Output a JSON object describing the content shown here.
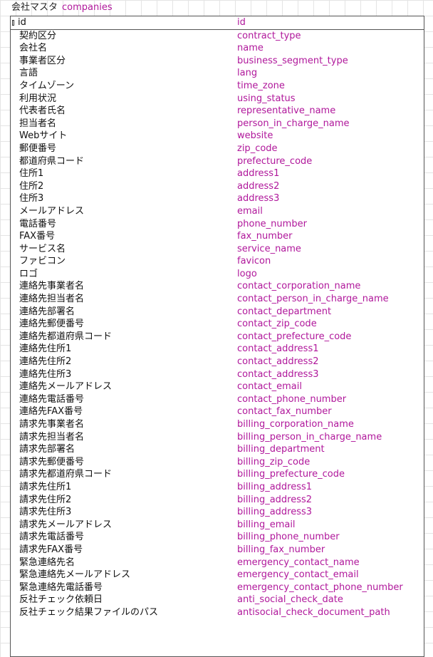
{
  "entity": {
    "logical_name": "会社マスタ",
    "physical_name": "companies"
  },
  "primary_key": {
    "logical": "id",
    "physical": "id"
  },
  "attributes": [
    {
      "logical": "契約区分",
      "physical": "contract_type"
    },
    {
      "logical": "会社名",
      "physical": "name"
    },
    {
      "logical": "事業者区分",
      "physical": "business_segment_type"
    },
    {
      "logical": "言語",
      "physical": "lang"
    },
    {
      "logical": "タイムゾーン",
      "physical": "time_zone"
    },
    {
      "logical": "利用状況",
      "physical": "using_status"
    },
    {
      "logical": "代表者氏名",
      "physical": "representative_name"
    },
    {
      "logical": "担当者名",
      "physical": "person_in_charge_name"
    },
    {
      "logical": "Webサイト",
      "physical": "website"
    },
    {
      "logical": "郵便番号",
      "physical": "zip_code"
    },
    {
      "logical": "都道府県コード",
      "physical": "prefecture_code"
    },
    {
      "logical": "住所1",
      "physical": "address1"
    },
    {
      "logical": "住所2",
      "physical": "address2"
    },
    {
      "logical": "住所3",
      "physical": "address3"
    },
    {
      "logical": "メールアドレス",
      "physical": "email"
    },
    {
      "logical": "電話番号",
      "physical": "phone_number"
    },
    {
      "logical": "FAX番号",
      "physical": "fax_number"
    },
    {
      "logical": "サービス名",
      "physical": "service_name"
    },
    {
      "logical": "ファビコン",
      "physical": "favicon"
    },
    {
      "logical": "ロゴ",
      "physical": "logo"
    },
    {
      "logical": "連絡先事業者名",
      "physical": "contact_corporation_name"
    },
    {
      "logical": "連絡先担当者名",
      "physical": "contact_person_in_charge_name"
    },
    {
      "logical": "連絡先部署名",
      "physical": "contact_department"
    },
    {
      "logical": "連絡先郵便番号",
      "physical": "contact_zip_code"
    },
    {
      "logical": "連絡先都道府県コード",
      "physical": "contact_prefecture_code"
    },
    {
      "logical": "連絡先住所1",
      "physical": "contact_address1"
    },
    {
      "logical": "連絡先住所2",
      "physical": "contact_address2"
    },
    {
      "logical": "連絡先住所3",
      "physical": "contact_address3"
    },
    {
      "logical": "連絡先メールアドレス",
      "physical": "contact_email"
    },
    {
      "logical": "連絡先電話番号",
      "physical": "contact_phone_number"
    },
    {
      "logical": "連絡先FAX番号",
      "physical": "contact_fax_number"
    },
    {
      "logical": "請求先事業者名",
      "physical": "billing_corporation_name"
    },
    {
      "logical": "請求先担当者名",
      "physical": "billing_person_in_charge_name"
    },
    {
      "logical": "請求先部署名",
      "physical": "billing_department"
    },
    {
      "logical": "請求先郵便番号",
      "physical": "billing_zip_code"
    },
    {
      "logical": "請求先都道府県コード",
      "physical": "billing_prefecture_code"
    },
    {
      "logical": "請求先住所1",
      "physical": "billing_address1"
    },
    {
      "logical": "請求先住所2",
      "physical": "billing_address2"
    },
    {
      "logical": "請求先住所3",
      "physical": "billing_address3"
    },
    {
      "logical": "請求先メールアドレス",
      "physical": "billing_email"
    },
    {
      "logical": "請求先電話番号",
      "physical": "billing_phone_number"
    },
    {
      "logical": "請求先FAX番号",
      "physical": "billing_fax_number"
    },
    {
      "logical": "緊急連絡先名",
      "physical": "emergency_contact_name"
    },
    {
      "logical": "緊急連絡先メールアドレス",
      "physical": "emergency_contact_email"
    },
    {
      "logical": "緊急連絡先電話番号",
      "physical": "emergency_contact_phone_number"
    },
    {
      "logical": "反社チェック依頼日",
      "physical": "anti_social_check_date"
    },
    {
      "logical": "反社チェック結果ファイルのパス",
      "physical": "antisocial_check_document_path"
    }
  ],
  "colors": {
    "physical_name": "#b0179b",
    "logical_name": "#111111",
    "border": "#555555",
    "grid": "#e4e4e4"
  }
}
